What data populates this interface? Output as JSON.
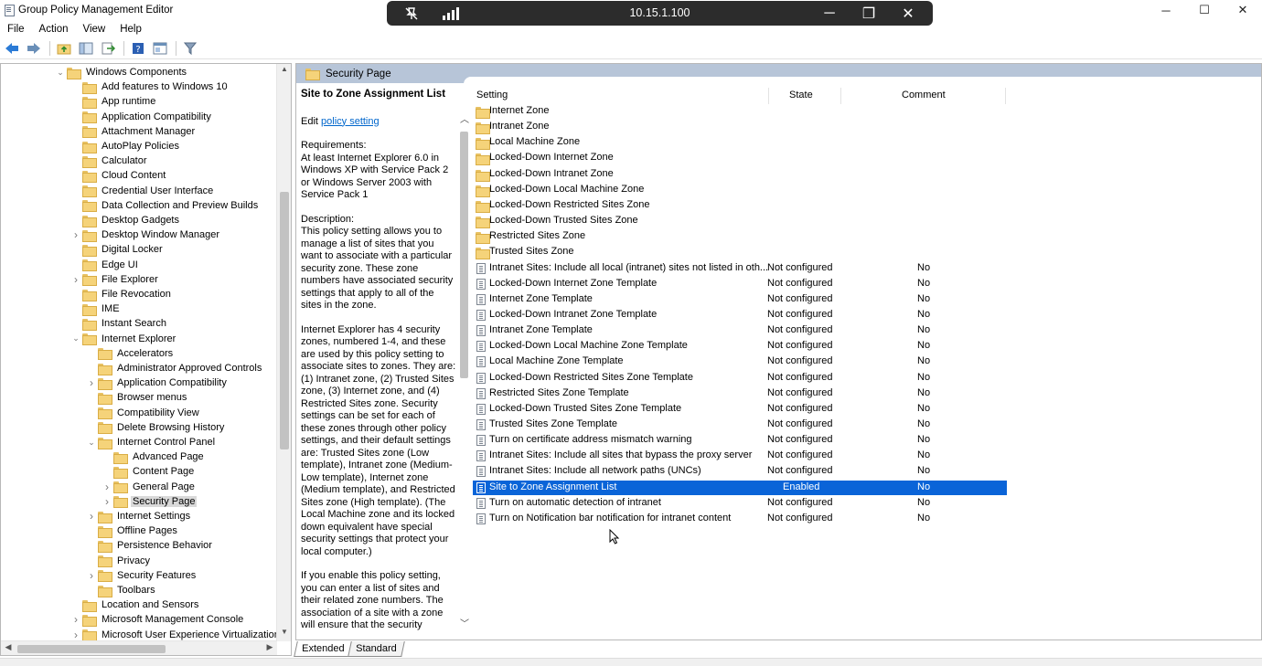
{
  "window": {
    "title": "Group Policy Management Editor",
    "controls": {
      "minimize": "─",
      "maximize": "☐",
      "close": "✕"
    }
  },
  "rdp": {
    "host": "10.15.1.100",
    "controls": {
      "minimize": "─",
      "restore": "❐",
      "close": "✕"
    }
  },
  "menu": [
    "File",
    "Action",
    "View",
    "Help"
  ],
  "toolbar_icons": [
    "back-arrow-icon",
    "forward-arrow-icon",
    "up-folder-icon",
    "show-hide-tree-icon",
    "export-list-icon",
    "help-icon",
    "properties-icon",
    "filter-icon"
  ],
  "tree": [
    {
      "label": "Windows Components",
      "level": 2,
      "exp": "open"
    },
    {
      "label": "Add features to Windows 10",
      "level": 3,
      "exp": ""
    },
    {
      "label": "App runtime",
      "level": 3,
      "exp": ""
    },
    {
      "label": "Application Compatibility",
      "level": 3,
      "exp": ""
    },
    {
      "label": "Attachment Manager",
      "level": 3,
      "exp": ""
    },
    {
      "label": "AutoPlay Policies",
      "level": 3,
      "exp": ""
    },
    {
      "label": "Calculator",
      "level": 3,
      "exp": ""
    },
    {
      "label": "Cloud Content",
      "level": 3,
      "exp": ""
    },
    {
      "label": "Credential User Interface",
      "level": 3,
      "exp": ""
    },
    {
      "label": "Data Collection and Preview Builds",
      "level": 3,
      "exp": ""
    },
    {
      "label": "Desktop Gadgets",
      "level": 3,
      "exp": ""
    },
    {
      "label": "Desktop Window Manager",
      "level": 3,
      "exp": "closed"
    },
    {
      "label": "Digital Locker",
      "level": 3,
      "exp": ""
    },
    {
      "label": "Edge UI",
      "level": 3,
      "exp": ""
    },
    {
      "label": "File Explorer",
      "level": 3,
      "exp": "closed"
    },
    {
      "label": "File Revocation",
      "level": 3,
      "exp": ""
    },
    {
      "label": "IME",
      "level": 3,
      "exp": ""
    },
    {
      "label": "Instant Search",
      "level": 3,
      "exp": ""
    },
    {
      "label": "Internet Explorer",
      "level": 3,
      "exp": "open"
    },
    {
      "label": "Accelerators",
      "level": 4,
      "exp": ""
    },
    {
      "label": "Administrator Approved Controls",
      "level": 4,
      "exp": ""
    },
    {
      "label": "Application Compatibility",
      "level": 4,
      "exp": "closed"
    },
    {
      "label": "Browser menus",
      "level": 4,
      "exp": ""
    },
    {
      "label": "Compatibility View",
      "level": 4,
      "exp": ""
    },
    {
      "label": "Delete Browsing History",
      "level": 4,
      "exp": ""
    },
    {
      "label": "Internet Control Panel",
      "level": 4,
      "exp": "open"
    },
    {
      "label": "Advanced Page",
      "level": 5,
      "exp": ""
    },
    {
      "label": "Content Page",
      "level": 5,
      "exp": ""
    },
    {
      "label": "General Page",
      "level": 5,
      "exp": "closed"
    },
    {
      "label": "Security Page",
      "level": 5,
      "exp": "closed",
      "selected": true
    },
    {
      "label": "Internet Settings",
      "level": 4,
      "exp": "closed"
    },
    {
      "label": "Offline Pages",
      "level": 4,
      "exp": ""
    },
    {
      "label": "Persistence Behavior",
      "level": 4,
      "exp": ""
    },
    {
      "label": "Privacy",
      "level": 4,
      "exp": ""
    },
    {
      "label": "Security Features",
      "level": 4,
      "exp": "closed"
    },
    {
      "label": "Toolbars",
      "level": 4,
      "exp": ""
    },
    {
      "label": "Location and Sensors",
      "level": 3,
      "exp": ""
    },
    {
      "label": "Microsoft Management Console",
      "level": 3,
      "exp": "closed"
    },
    {
      "label": "Microsoft User Experience Virtualization",
      "level": 3,
      "exp": "closed"
    }
  ],
  "pane_header": {
    "title": "Security Page"
  },
  "description": {
    "title": "Site to Zone Assignment List",
    "edit_prefix": "Edit ",
    "edit_link": "policy setting ",
    "requirements": "Requirements:\nAt least Internet Explorer 6.0 in Windows XP with Service Pack 2 or Windows Server 2003 with Service Pack 1",
    "description": "Description:\nThis policy setting allows you to manage a list of sites that you want to associate with a particular security zone. These zone numbers have associated security settings that apply to all of the sites in the zone.",
    "paragraph2": "Internet Explorer has 4 security zones, numbered 1-4, and these are used by this policy setting to associate sites to zones. They are: (1) Intranet zone, (2) Trusted Sites zone, (3) Internet zone, and (4) Restricted Sites zone. Security settings can be set for each of these zones through other policy settings, and their default settings are: Trusted Sites zone (Low template), Intranet zone (Medium-Low template), Internet zone (Medium template), and Restricted Sites zone (High template). (The Local Machine zone and its locked down equivalent have special security settings that protect your local computer.)",
    "paragraph3": "If you enable this policy setting, you can enter a list of sites and their related zone numbers. The association of a site with a zone will ensure that the security"
  },
  "columns": {
    "setting": "Setting",
    "state": "State",
    "comment": "Comment"
  },
  "settings": [
    {
      "name": "Internet Zone",
      "type": "folder",
      "state": "",
      "comment": ""
    },
    {
      "name": "Intranet Zone",
      "type": "folder",
      "state": "",
      "comment": ""
    },
    {
      "name": "Local Machine Zone",
      "type": "folder",
      "state": "",
      "comment": ""
    },
    {
      "name": "Locked-Down Internet Zone",
      "type": "folder",
      "state": "",
      "comment": ""
    },
    {
      "name": "Locked-Down Intranet Zone",
      "type": "folder",
      "state": "",
      "comment": ""
    },
    {
      "name": "Locked-Down Local Machine Zone",
      "type": "folder",
      "state": "",
      "comment": ""
    },
    {
      "name": "Locked-Down Restricted Sites Zone",
      "type": "folder",
      "state": "",
      "comment": ""
    },
    {
      "name": "Locked-Down Trusted Sites Zone",
      "type": "folder",
      "state": "",
      "comment": ""
    },
    {
      "name": "Restricted Sites Zone",
      "type": "folder",
      "state": "",
      "comment": ""
    },
    {
      "name": "Trusted Sites Zone",
      "type": "folder",
      "state": "",
      "comment": ""
    },
    {
      "name": "Intranet Sites: Include all local (intranet) sites not listed in oth...",
      "type": "setting",
      "state": "Not configured",
      "comment": "No"
    },
    {
      "name": "Locked-Down Internet Zone Template",
      "type": "setting",
      "state": "Not configured",
      "comment": "No"
    },
    {
      "name": "Internet Zone Template",
      "type": "setting",
      "state": "Not configured",
      "comment": "No"
    },
    {
      "name": "Locked-Down Intranet Zone Template",
      "type": "setting",
      "state": "Not configured",
      "comment": "No"
    },
    {
      "name": "Intranet Zone Template",
      "type": "setting",
      "state": "Not configured",
      "comment": "No"
    },
    {
      "name": "Locked-Down Local Machine Zone Template",
      "type": "setting",
      "state": "Not configured",
      "comment": "No"
    },
    {
      "name": "Local Machine Zone Template",
      "type": "setting",
      "state": "Not configured",
      "comment": "No"
    },
    {
      "name": "Locked-Down Restricted Sites Zone Template",
      "type": "setting",
      "state": "Not configured",
      "comment": "No"
    },
    {
      "name": "Restricted Sites Zone Template",
      "type": "setting",
      "state": "Not configured",
      "comment": "No"
    },
    {
      "name": "Locked-Down Trusted Sites Zone Template",
      "type": "setting",
      "state": "Not configured",
      "comment": "No"
    },
    {
      "name": "Trusted Sites Zone Template",
      "type": "setting",
      "state": "Not configured",
      "comment": "No"
    },
    {
      "name": "Turn on certificate address mismatch warning",
      "type": "setting",
      "state": "Not configured",
      "comment": "No"
    },
    {
      "name": "Intranet Sites: Include all sites that bypass the proxy server",
      "type": "setting",
      "state": "Not configured",
      "comment": "No"
    },
    {
      "name": "Intranet Sites: Include all network paths (UNCs)",
      "type": "setting",
      "state": "Not configured",
      "comment": "No"
    },
    {
      "name": "Site to Zone Assignment List",
      "type": "setting",
      "state": "Enabled",
      "comment": "No",
      "selected": true
    },
    {
      "name": "Turn on automatic detection of intranet",
      "type": "setting",
      "state": "Not configured",
      "comment": "No"
    },
    {
      "name": "Turn on Notification bar notification for intranet content",
      "type": "setting",
      "state": "Not configured",
      "comment": "No"
    }
  ],
  "bottom_tabs": [
    "Extended",
    "Standard"
  ],
  "colors": {
    "header_band": "#b7c5d8",
    "selection": "#0a64d8",
    "link": "#0066cc",
    "rdp_bar": "#2c2c2c"
  }
}
